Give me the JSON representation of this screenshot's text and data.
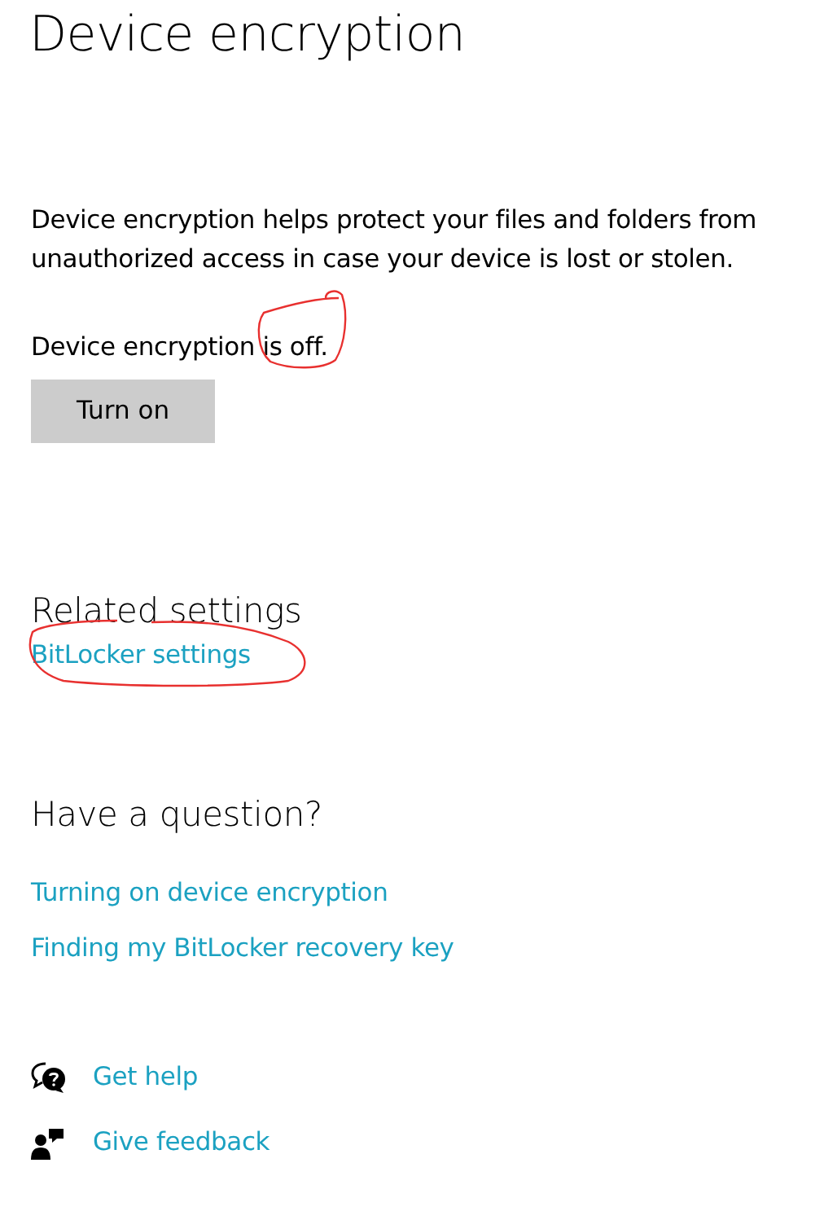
{
  "title": "Device encryption",
  "description": "Device encryption helps protect your files and folders from unauthorized access in case your device is lost or stolen.",
  "status": {
    "text": "Device encryption is off.",
    "on": false
  },
  "turn_on_button": "Turn on",
  "related_settings": {
    "heading": "Related settings",
    "links": [
      {
        "label": "BitLocker settings",
        "annotated": true
      }
    ]
  },
  "question": {
    "heading": "Have a question?",
    "links": [
      "Turning on device encryption",
      "Finding my BitLocker recovery key"
    ]
  },
  "help_links": [
    {
      "kind": "help",
      "label": "Get help"
    },
    {
      "kind": "feedback",
      "label": "Give feedback"
    }
  ]
}
